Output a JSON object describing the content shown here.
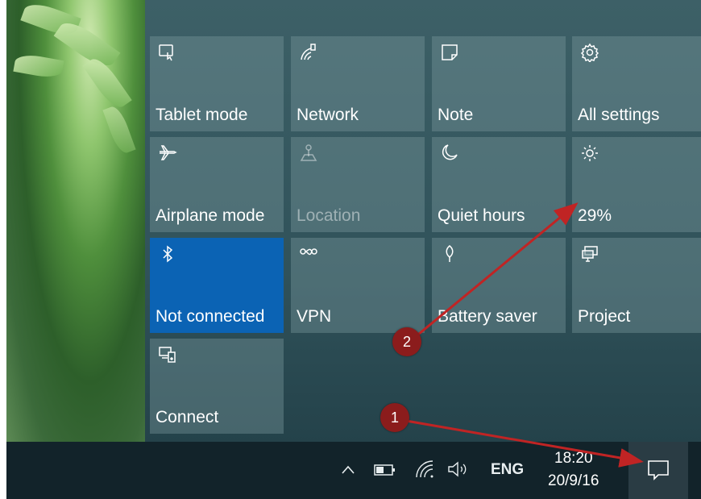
{
  "tiles": [
    {
      "label": "Tablet mode",
      "icon": "tablet-mode-icon"
    },
    {
      "label": "Network",
      "icon": "network-icon"
    },
    {
      "label": "Note",
      "icon": "note-icon"
    },
    {
      "label": "All settings",
      "icon": "gear-icon"
    },
    {
      "label": "Airplane mode",
      "icon": "airplane-icon"
    },
    {
      "label": "Location",
      "icon": "location-icon",
      "disabled": true
    },
    {
      "label": "Quiet hours",
      "icon": "moon-icon"
    },
    {
      "label": "29%",
      "icon": "brightness-icon"
    },
    {
      "label": "Not connected",
      "icon": "bluetooth-icon",
      "active": true
    },
    {
      "label": "VPN",
      "icon": "vpn-icon"
    },
    {
      "label": "Battery saver",
      "icon": "battery-saver-icon"
    },
    {
      "label": "Project",
      "icon": "project-icon"
    },
    {
      "label": "Connect",
      "icon": "connect-icon"
    }
  ],
  "taskbar": {
    "language": "ENG",
    "time": "18:20",
    "date": "20/9/16"
  },
  "annotations": [
    {
      "label": "1"
    },
    {
      "label": "2"
    }
  ],
  "colors": {
    "active_tile": "#0b63b4",
    "annotation": "#b01e1e"
  }
}
